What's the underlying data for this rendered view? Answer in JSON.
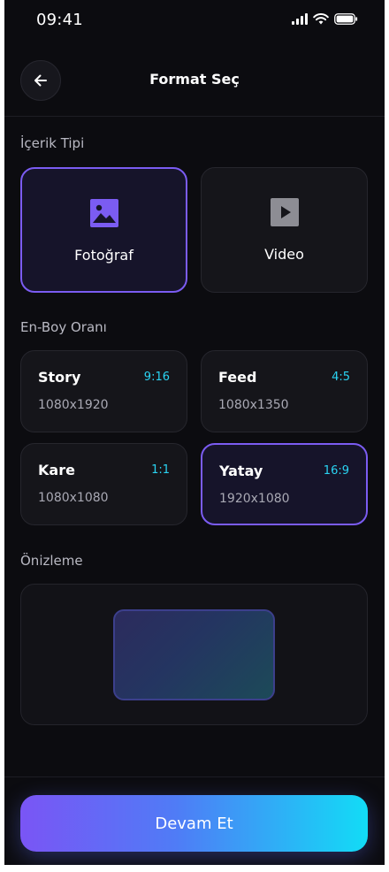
{
  "status_bar": {
    "time": "09:41"
  },
  "header": {
    "title": "Format Seç"
  },
  "content_type": {
    "label": "İçerik Tipi",
    "options": [
      {
        "label": "Fotoğraf",
        "icon": "image-icon",
        "selected": true
      },
      {
        "label": "Video",
        "icon": "play-icon",
        "selected": false
      }
    ]
  },
  "aspect_ratio": {
    "label": "En-Boy Oranı",
    "options": [
      {
        "name": "Story",
        "ratio": "9:16",
        "resolution": "1080x1920",
        "selected": false
      },
      {
        "name": "Feed",
        "ratio": "4:5",
        "resolution": "1080x1350",
        "selected": false
      },
      {
        "name": "Kare",
        "ratio": "1:1",
        "resolution": "1080x1080",
        "selected": false
      },
      {
        "name": "Yatay",
        "ratio": "16:9",
        "resolution": "1920x1080",
        "selected": true
      }
    ]
  },
  "preview": {
    "label": "Önizleme"
  },
  "cta": {
    "label": "Devam Et"
  },
  "colors": {
    "accent_purple": "#7b5cf2",
    "accent_cyan": "#2ad4f3",
    "background": "#0c0c10"
  }
}
